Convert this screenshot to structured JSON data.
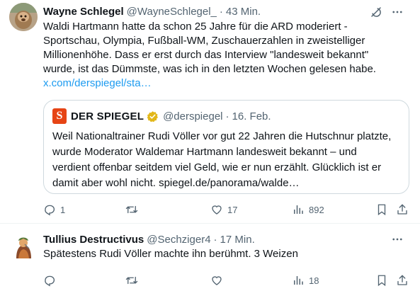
{
  "tweets": [
    {
      "author": {
        "name": "Wayne Schlegel",
        "handle": "@WayneSchlegel_",
        "time": "43 Min."
      },
      "text": "Waldi Hartmann hatte da schon 25 Jahre für die ARD moderiert -\nSportschau, Olympia, Fußball-WM, Zuschauerzahlen in zweistelliger\nMillionenhöhe. Dass er erst durch das Interview \"landesweit bekannt\"\nwurde, ist das Dümmste, was ich in den letzten Wochen gelesen habe.",
      "link": "x.com/derspiegel/sta…",
      "quote": {
        "logo_letter": "S",
        "name": "DER SPIEGEL",
        "handle": "@derspiegel",
        "date": "16. Feb.",
        "text": "Weil Nationaltrainer Rudi Völler vor gut 22 Jahren die Hutschnur platzte,\nwurde Moderator Waldemar Hartmann landesweit bekannt – und\nverdient offenbar seitdem viel Geld, wie er nun erzählt. Glücklich ist er\ndamit aber wohl nicht. spiegel.de/panorama/walde…"
      },
      "actions": {
        "replies": "1",
        "retweets": "",
        "likes": "17",
        "views": "892"
      }
    },
    {
      "author": {
        "name": "Tullius Destructivus",
        "handle": "@Sechziger4",
        "time": "17 Min."
      },
      "text": "Spätestens Rudi Völler machte ihn berühmt. 3 Weizen",
      "actions": {
        "replies": "",
        "retweets": "",
        "likes": "",
        "views": "18"
      }
    }
  ],
  "separator": "·",
  "icons": {
    "reply": "reply-icon",
    "retweet": "retweet-icon",
    "like": "heart-icon",
    "views": "views-icon",
    "bookmark": "bookmark-icon",
    "share": "share-icon",
    "more": "more-icon",
    "grok": "grok-icon",
    "verified": "verified-gold-badge-icon"
  },
  "colors": {
    "text": "#0f1419",
    "secondary": "#536471",
    "link": "#1d9bf0",
    "border": "#cfd9de",
    "spiegel": "#e64415",
    "verified_gold": "#e2b719"
  }
}
